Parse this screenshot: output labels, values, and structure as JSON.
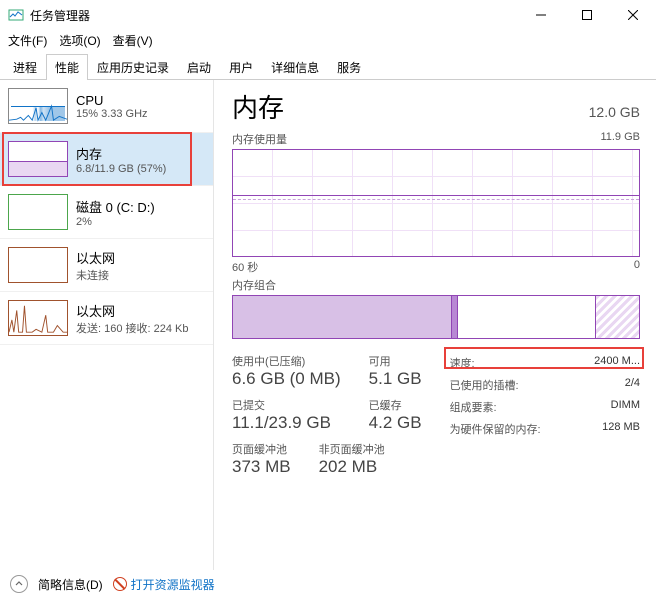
{
  "window": {
    "title": "任务管理器"
  },
  "menu": {
    "file": "文件(F)",
    "options": "选项(O)",
    "view": "查看(V)"
  },
  "tabs": [
    "进程",
    "性能",
    "应用历史记录",
    "启动",
    "用户",
    "详细信息",
    "服务"
  ],
  "active_tab": 1,
  "sidebar": {
    "items": [
      {
        "title": "CPU",
        "sub": "15% 3.33 GHz"
      },
      {
        "title": "内存",
        "sub": "6.8/11.9 GB (57%)"
      },
      {
        "title": "磁盘 0 (C: D:)",
        "sub": "2%"
      },
      {
        "title": "以太网",
        "sub": "未连接"
      },
      {
        "title": "以太网",
        "sub": "发送: 160 接收: 224 Kb"
      }
    ]
  },
  "main": {
    "heading": "内存",
    "total": "12.0 GB",
    "usage_label": "内存使用量",
    "usage_max": "11.9 GB",
    "x_left": "60 秒",
    "x_right": "0",
    "comp_label": "内存组合",
    "stats": {
      "inuse_label": "使用中(已压缩)",
      "inuse_val": "6.6 GB (0 MB)",
      "avail_label": "可用",
      "avail_val": "5.1 GB",
      "commit_label": "已提交",
      "commit_val": "11.1/23.9 GB",
      "cached_label": "已缓存",
      "cached_val": "4.2 GB",
      "paged_label": "页面缓冲池",
      "paged_val": "373 MB",
      "nonpaged_label": "非页面缓冲池",
      "nonpaged_val": "202 MB"
    },
    "right": {
      "speed_k": "速度:",
      "speed_v": "2400 M...",
      "slots_k": "已使用的插槽:",
      "slots_v": "2/4",
      "form_k": "组成要素:",
      "form_v": "DIMM",
      "reserved_k": "为硬件保留的内存:",
      "reserved_v": "128 MB"
    }
  },
  "footer": {
    "less": "简略信息(D)",
    "resmon": "打开资源监视器"
  },
  "chart_data": {
    "type": "line",
    "title": "内存使用量",
    "x_range_seconds": [
      60,
      0
    ],
    "ylim": [
      0,
      11.9
    ],
    "series": [
      {
        "name": "used_gb",
        "approx_constant": 6.8
      },
      {
        "name": "available_boundary_gb",
        "approx_constant": 6.4
      }
    ],
    "composition_bar": {
      "total_gb": 11.9,
      "segments": [
        {
          "name": "in_use",
          "gb": 6.6
        },
        {
          "name": "modified",
          "gb": 0.2
        },
        {
          "name": "standby",
          "gb": 4.2
        },
        {
          "name": "free",
          "gb": 0.9
        }
      ]
    }
  }
}
